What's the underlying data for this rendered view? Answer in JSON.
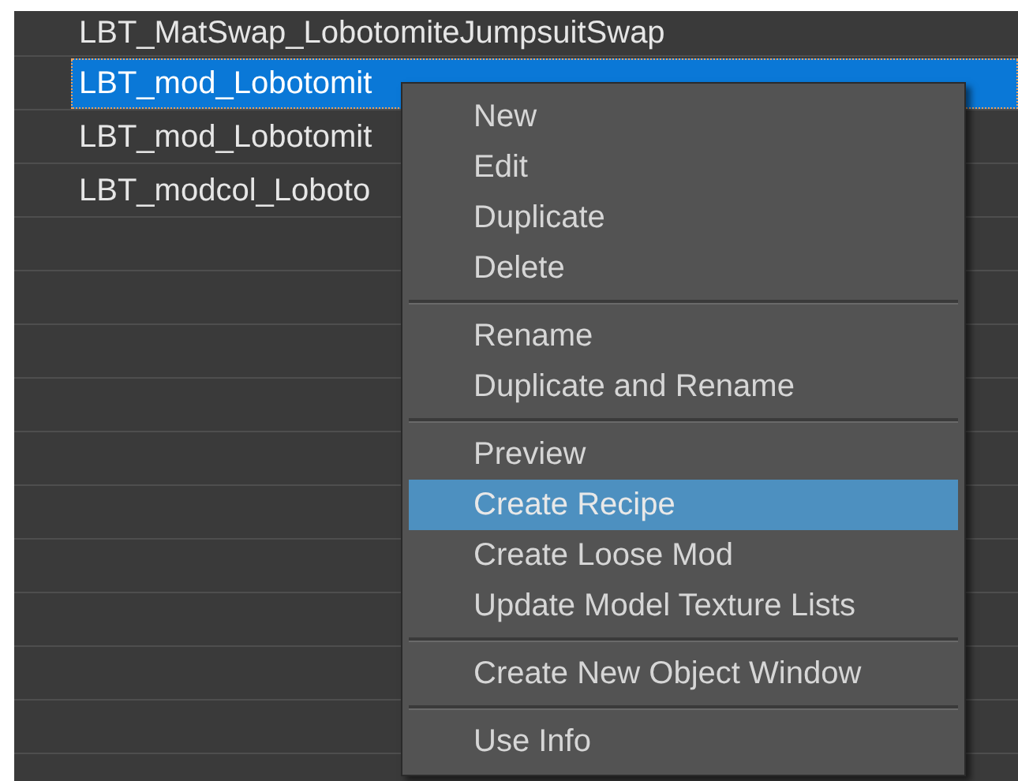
{
  "list": {
    "rows": [
      {
        "label": "LBT_MatSwap_LobotomiteJumpsuitSwap",
        "selected": false
      },
      {
        "label": "LBT_mod_Lobotomit",
        "selected": true
      },
      {
        "label": "LBT_mod_Lobotomit",
        "selected": false
      },
      {
        "label": "LBT_modcol_Loboto",
        "selected": false
      }
    ]
  },
  "context_menu": {
    "items": [
      {
        "kind": "item",
        "label": "New",
        "selected": false
      },
      {
        "kind": "item",
        "label": "Edit",
        "selected": false
      },
      {
        "kind": "item",
        "label": "Duplicate",
        "selected": false
      },
      {
        "kind": "item",
        "label": "Delete",
        "selected": false
      },
      {
        "kind": "separator"
      },
      {
        "kind": "item",
        "label": "Rename",
        "selected": false
      },
      {
        "kind": "item",
        "label": "Duplicate and Rename",
        "selected": false
      },
      {
        "kind": "separator"
      },
      {
        "kind": "item",
        "label": "Preview",
        "selected": false
      },
      {
        "kind": "item",
        "label": "Create Recipe",
        "selected": true
      },
      {
        "kind": "item",
        "label": "Create Loose Mod",
        "selected": false
      },
      {
        "kind": "item",
        "label": "Update Model Texture Lists",
        "selected": false
      },
      {
        "kind": "separator"
      },
      {
        "kind": "item",
        "label": "Create New Object Window",
        "selected": false
      },
      {
        "kind": "separator"
      },
      {
        "kind": "item",
        "label": "Use Info",
        "selected": false
      }
    ]
  }
}
